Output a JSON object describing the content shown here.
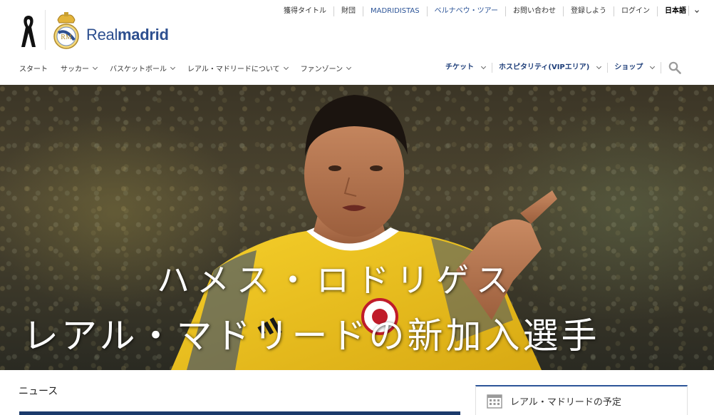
{
  "brand": {
    "wordmark_light": "Real",
    "wordmark_bold": "madrid"
  },
  "utility_nav": [
    {
      "label": "獲得タイトル",
      "style": "normal"
    },
    {
      "label": "財団",
      "style": "normal"
    },
    {
      "label": "MADRIDISTAS",
      "style": "blue"
    },
    {
      "label": "ベルナベウ・ツアー",
      "style": "blue"
    },
    {
      "label": "お問い合わせ",
      "style": "normal"
    },
    {
      "label": "登録しよう",
      "style": "normal"
    },
    {
      "label": "ログイン",
      "style": "normal"
    },
    {
      "label": "日本語",
      "style": "lang"
    }
  ],
  "main_nav": [
    {
      "label": "スタート",
      "has_dropdown": false
    },
    {
      "label": "サッカー",
      "has_dropdown": true
    },
    {
      "label": "バスケットボール",
      "has_dropdown": true
    },
    {
      "label": "レアル・マドリードについて",
      "has_dropdown": true
    },
    {
      "label": "ファンゾーン",
      "has_dropdown": true
    }
  ],
  "right_nav": [
    {
      "label": "チケット"
    },
    {
      "label": "ホスピタリティ(VIPエリア)"
    },
    {
      "label": "ショップ"
    }
  ],
  "hero": {
    "line1": "ハメス・ロドリゲス",
    "line2": "レアル・マドリードの新加入選手"
  },
  "news": {
    "title": "ニュース"
  },
  "schedule": {
    "label": "レアル・マドリードの予定"
  },
  "colors": {
    "brand_blue": "#2d4f8f",
    "nav_blue": "#1f3f7a",
    "link_blue": "#2d5598",
    "jersey_yellow": "#f2c51a"
  },
  "icons": [
    "mourning-ribbon-icon",
    "club-crest-icon",
    "chevron-down-icon",
    "search-icon",
    "calendar-icon"
  ]
}
